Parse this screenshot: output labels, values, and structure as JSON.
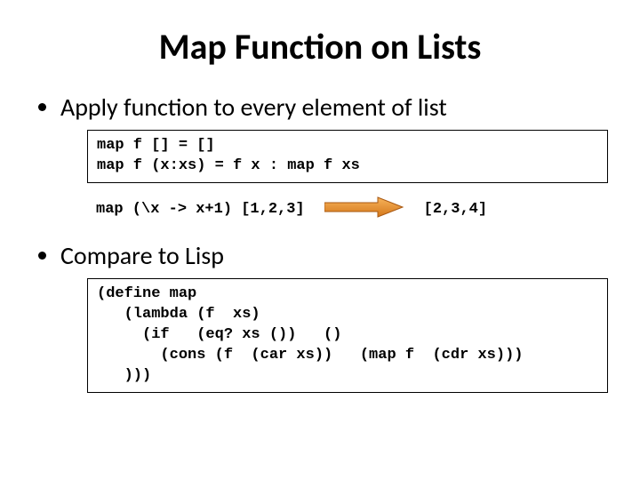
{
  "title": "Map Function on Lists",
  "bullet1": "Apply function to every element of list",
  "bullet2": "Compare to Lisp",
  "code_haskell": "map f [] = []\nmap f (x:xs) = f x : map f xs",
  "eval_input": "map (\\x -> x+1) [1,2,3]",
  "eval_output": "[2,3,4]",
  "code_lisp": "(define map\n   (lambda (f  xs)\n     (if   (eq? xs ())   ()\n       (cons (f  (car xs))   (map f  (cdr xs)))\n   )))"
}
